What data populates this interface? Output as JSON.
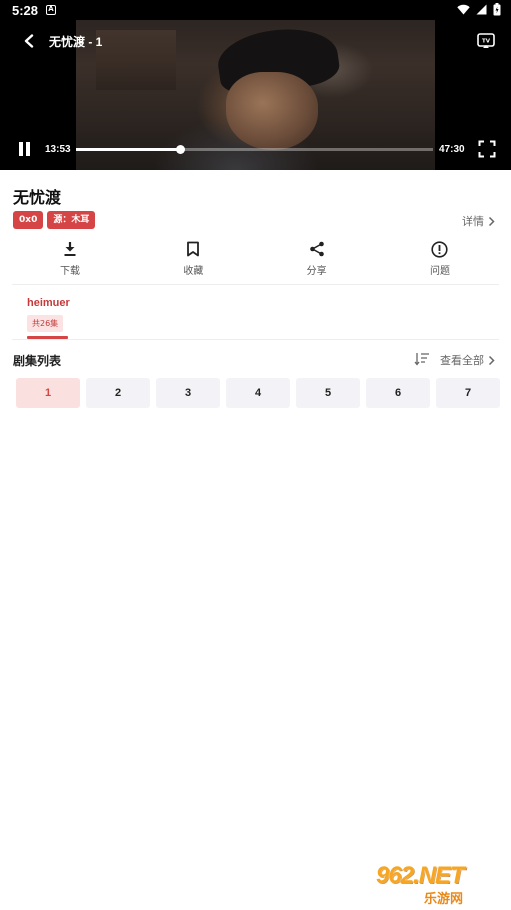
{
  "status_bar": {
    "time": "5:28",
    "notification_icon": "A",
    "icons": [
      "wifi-icon",
      "signal-icon",
      "battery-icon"
    ]
  },
  "player": {
    "title": "无忧渡 - 1",
    "current_time": "13:53",
    "total_time": "47:30",
    "progress_fraction": 0.29,
    "state": "playing"
  },
  "show": {
    "title": "无忧渡",
    "badges": [
      "0x0",
      "源：木耳"
    ],
    "details_label": "详情"
  },
  "actions": [
    {
      "label": "下载",
      "icon": "download-icon"
    },
    {
      "label": "收藏",
      "icon": "bookmark-icon"
    },
    {
      "label": "分享",
      "icon": "share-icon"
    },
    {
      "label": "问题",
      "icon": "alert-icon"
    }
  ],
  "source": {
    "name": "heimuer",
    "episode_count": "共26集"
  },
  "episode_list": {
    "heading": "剧集列表",
    "view_all_label": "查看全部",
    "episodes": [
      "1",
      "2",
      "3",
      "4",
      "5",
      "6",
      "7"
    ],
    "active_index": 0
  },
  "watermark": {
    "top": "962.NET",
    "bottom": "乐游网"
  },
  "colors": {
    "accent": "#d64545",
    "accent_light": "#fbe0e0",
    "episode_bg": "#f3f3f7"
  }
}
